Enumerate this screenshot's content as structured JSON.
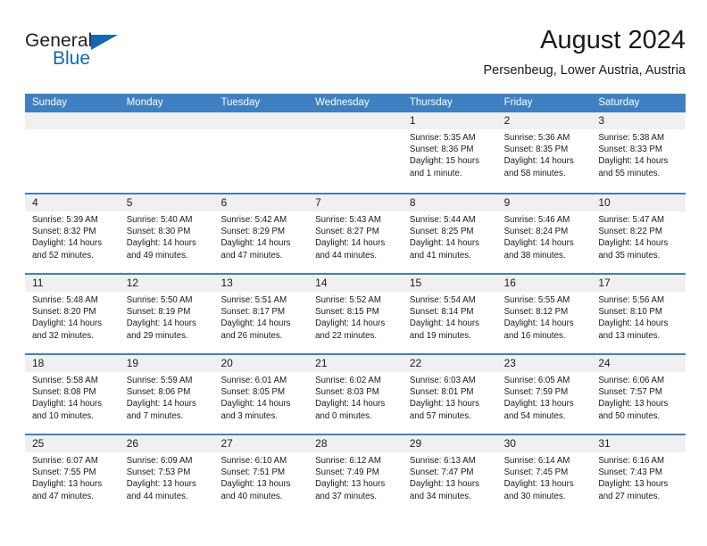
{
  "brand": {
    "name_top": "General",
    "name_bottom": "Blue",
    "flag_color": "#1268b3"
  },
  "header": {
    "title": "August 2024",
    "subtitle": "Persenbeug, Lower Austria, Austria"
  },
  "calendar": {
    "header_bg": "#3f80c2",
    "weekdays": [
      "Sunday",
      "Monday",
      "Tuesday",
      "Wednesday",
      "Thursday",
      "Friday",
      "Saturday"
    ],
    "weeks": [
      [
        {
          "day": "",
          "sunrise": "",
          "sunset": "",
          "daylight": "",
          "empty": true
        },
        {
          "day": "",
          "sunrise": "",
          "sunset": "",
          "daylight": "",
          "empty": true
        },
        {
          "day": "",
          "sunrise": "",
          "sunset": "",
          "daylight": "",
          "empty": true
        },
        {
          "day": "",
          "sunrise": "",
          "sunset": "",
          "daylight": "",
          "empty": true
        },
        {
          "day": "1",
          "sunrise": "Sunrise: 5:35 AM",
          "sunset": "Sunset: 8:36 PM",
          "daylight": "Daylight: 15 hours and 1 minute."
        },
        {
          "day": "2",
          "sunrise": "Sunrise: 5:36 AM",
          "sunset": "Sunset: 8:35 PM",
          "daylight": "Daylight: 14 hours and 58 minutes."
        },
        {
          "day": "3",
          "sunrise": "Sunrise: 5:38 AM",
          "sunset": "Sunset: 8:33 PM",
          "daylight": "Daylight: 14 hours and 55 minutes."
        }
      ],
      [
        {
          "day": "4",
          "sunrise": "Sunrise: 5:39 AM",
          "sunset": "Sunset: 8:32 PM",
          "daylight": "Daylight: 14 hours and 52 minutes."
        },
        {
          "day": "5",
          "sunrise": "Sunrise: 5:40 AM",
          "sunset": "Sunset: 8:30 PM",
          "daylight": "Daylight: 14 hours and 49 minutes."
        },
        {
          "day": "6",
          "sunrise": "Sunrise: 5:42 AM",
          "sunset": "Sunset: 8:29 PM",
          "daylight": "Daylight: 14 hours and 47 minutes."
        },
        {
          "day": "7",
          "sunrise": "Sunrise: 5:43 AM",
          "sunset": "Sunset: 8:27 PM",
          "daylight": "Daylight: 14 hours and 44 minutes."
        },
        {
          "day": "8",
          "sunrise": "Sunrise: 5:44 AM",
          "sunset": "Sunset: 8:25 PM",
          "daylight": "Daylight: 14 hours and 41 minutes."
        },
        {
          "day": "9",
          "sunrise": "Sunrise: 5:46 AM",
          "sunset": "Sunset: 8:24 PM",
          "daylight": "Daylight: 14 hours and 38 minutes."
        },
        {
          "day": "10",
          "sunrise": "Sunrise: 5:47 AM",
          "sunset": "Sunset: 8:22 PM",
          "daylight": "Daylight: 14 hours and 35 minutes."
        }
      ],
      [
        {
          "day": "11",
          "sunrise": "Sunrise: 5:48 AM",
          "sunset": "Sunset: 8:20 PM",
          "daylight": "Daylight: 14 hours and 32 minutes."
        },
        {
          "day": "12",
          "sunrise": "Sunrise: 5:50 AM",
          "sunset": "Sunset: 8:19 PM",
          "daylight": "Daylight: 14 hours and 29 minutes."
        },
        {
          "day": "13",
          "sunrise": "Sunrise: 5:51 AM",
          "sunset": "Sunset: 8:17 PM",
          "daylight": "Daylight: 14 hours and 26 minutes."
        },
        {
          "day": "14",
          "sunrise": "Sunrise: 5:52 AM",
          "sunset": "Sunset: 8:15 PM",
          "daylight": "Daylight: 14 hours and 22 minutes."
        },
        {
          "day": "15",
          "sunrise": "Sunrise: 5:54 AM",
          "sunset": "Sunset: 8:14 PM",
          "daylight": "Daylight: 14 hours and 19 minutes."
        },
        {
          "day": "16",
          "sunrise": "Sunrise: 5:55 AM",
          "sunset": "Sunset: 8:12 PM",
          "daylight": "Daylight: 14 hours and 16 minutes."
        },
        {
          "day": "17",
          "sunrise": "Sunrise: 5:56 AM",
          "sunset": "Sunset: 8:10 PM",
          "daylight": "Daylight: 14 hours and 13 minutes."
        }
      ],
      [
        {
          "day": "18",
          "sunrise": "Sunrise: 5:58 AM",
          "sunset": "Sunset: 8:08 PM",
          "daylight": "Daylight: 14 hours and 10 minutes."
        },
        {
          "day": "19",
          "sunrise": "Sunrise: 5:59 AM",
          "sunset": "Sunset: 8:06 PM",
          "daylight": "Daylight: 14 hours and 7 minutes."
        },
        {
          "day": "20",
          "sunrise": "Sunrise: 6:01 AM",
          "sunset": "Sunset: 8:05 PM",
          "daylight": "Daylight: 14 hours and 3 minutes."
        },
        {
          "day": "21",
          "sunrise": "Sunrise: 6:02 AM",
          "sunset": "Sunset: 8:03 PM",
          "daylight": "Daylight: 14 hours and 0 minutes."
        },
        {
          "day": "22",
          "sunrise": "Sunrise: 6:03 AM",
          "sunset": "Sunset: 8:01 PM",
          "daylight": "Daylight: 13 hours and 57 minutes."
        },
        {
          "day": "23",
          "sunrise": "Sunrise: 6:05 AM",
          "sunset": "Sunset: 7:59 PM",
          "daylight": "Daylight: 13 hours and 54 minutes."
        },
        {
          "day": "24",
          "sunrise": "Sunrise: 6:06 AM",
          "sunset": "Sunset: 7:57 PM",
          "daylight": "Daylight: 13 hours and 50 minutes."
        }
      ],
      [
        {
          "day": "25",
          "sunrise": "Sunrise: 6:07 AM",
          "sunset": "Sunset: 7:55 PM",
          "daylight": "Daylight: 13 hours and 47 minutes."
        },
        {
          "day": "26",
          "sunrise": "Sunrise: 6:09 AM",
          "sunset": "Sunset: 7:53 PM",
          "daylight": "Daylight: 13 hours and 44 minutes."
        },
        {
          "day": "27",
          "sunrise": "Sunrise: 6:10 AM",
          "sunset": "Sunset: 7:51 PM",
          "daylight": "Daylight: 13 hours and 40 minutes."
        },
        {
          "day": "28",
          "sunrise": "Sunrise: 6:12 AM",
          "sunset": "Sunset: 7:49 PM",
          "daylight": "Daylight: 13 hours and 37 minutes."
        },
        {
          "day": "29",
          "sunrise": "Sunrise: 6:13 AM",
          "sunset": "Sunset: 7:47 PM",
          "daylight": "Daylight: 13 hours and 34 minutes."
        },
        {
          "day": "30",
          "sunrise": "Sunrise: 6:14 AM",
          "sunset": "Sunset: 7:45 PM",
          "daylight": "Daylight: 13 hours and 30 minutes."
        },
        {
          "day": "31",
          "sunrise": "Sunrise: 6:16 AM",
          "sunset": "Sunset: 7:43 PM",
          "daylight": "Daylight: 13 hours and 27 minutes."
        }
      ]
    ]
  }
}
